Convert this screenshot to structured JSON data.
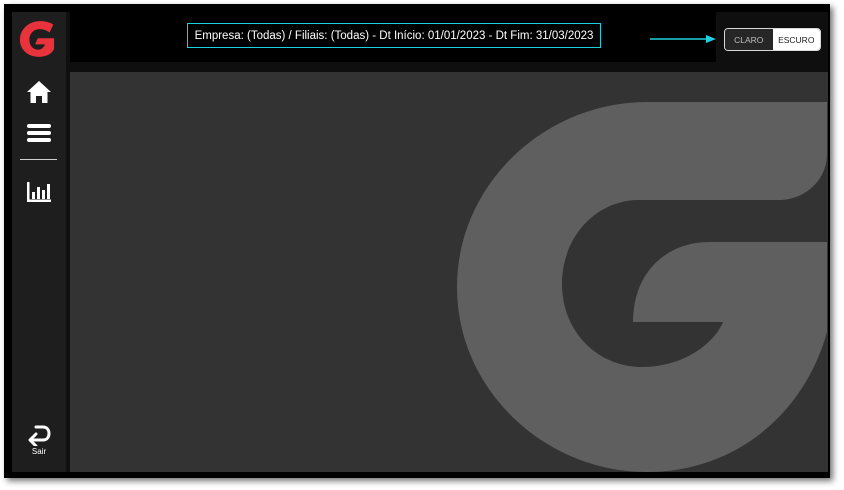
{
  "sidebar": {
    "items": [
      {
        "name": "home",
        "icon": "home-icon"
      },
      {
        "name": "menu",
        "icon": "menu-icon"
      },
      {
        "name": "reports",
        "icon": "bar-chart-icon"
      }
    ],
    "logout_label": "Sair",
    "logout_icon": "return-arrow-icon"
  },
  "header": {
    "filter_text": "Empresa: (Todas) / Filiais: (Todas) - Dt Início: 01/01/2023 - Dt Fim: 31/03/2023"
  },
  "theme_toggle": {
    "light_label": "CLARO",
    "dark_label": "ESCURO",
    "selected": "ESCURO"
  },
  "colors": {
    "brand_red": "#e8323c",
    "accent_cyan": "#1fd0e0",
    "background": "#333333",
    "sidebar": "#1e1e1e",
    "watermark": "#5f5f5f"
  }
}
